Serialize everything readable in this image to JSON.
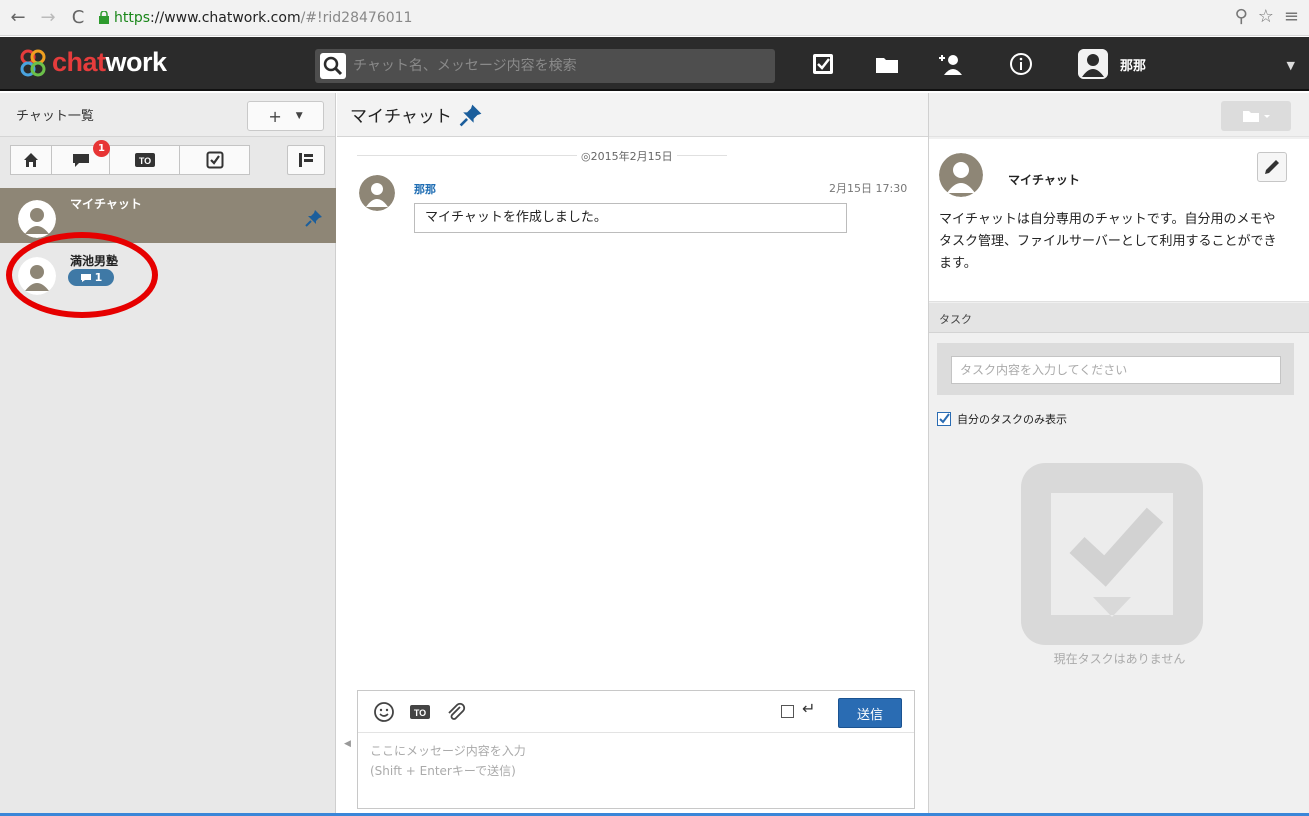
{
  "browser": {
    "url_scheme": "https",
    "url_host": "://www.chatwork.com",
    "url_path": "/#!rid28476011"
  },
  "header": {
    "logo_part1": "chat",
    "logo_part2": "work",
    "search_placeholder": "チャット名、メッセージ内容を検索",
    "username": "那那",
    "icons": [
      "task-icon",
      "folder-icon",
      "add-contact-icon",
      "info-icon"
    ]
  },
  "sidebar": {
    "title": "チャット一覧",
    "add_button": "+",
    "filter_unread_badge": "1",
    "filter_icons": [
      "home-icon",
      "unread-mention-icon",
      "to-icon",
      "task-check-icon"
    ],
    "rooms": [
      {
        "name": "マイチャット",
        "pinned": true,
        "selected": true
      },
      {
        "name": "満池男塾",
        "badge": "1"
      }
    ]
  },
  "main": {
    "room_title": "マイチャット",
    "date_separator": "◎2015年2月15日",
    "message": {
      "sender": "那那",
      "time": "2月15日 17:30",
      "body": "マイチャットを作成しました。"
    },
    "composer": {
      "placeholder": "ここにメッセージ内容を入力\n(Shift + Enterキーで送信)",
      "send_label": "送信"
    }
  },
  "right_panel": {
    "room_name": "マイチャット",
    "description": "マイチャットは自分専用のチャットです。自分用のメモやタスク管理、ファイルサーバーとして利用することができます。",
    "task_section_label": "タスク",
    "task_input_placeholder": "タスク内容を入力してください",
    "my_tasks_only_label": "自分のタスクのみ表示",
    "my_tasks_only_checked": true,
    "empty_text": "現在タスクはありません"
  },
  "colors": {
    "header_bg": "#2b2b2b",
    "logo_red": "#e53c3c",
    "selected_room": "#8e8676",
    "link_blue": "#1f6db3",
    "send_blue": "#2a6cb3",
    "annotation_red": "#e60000"
  }
}
